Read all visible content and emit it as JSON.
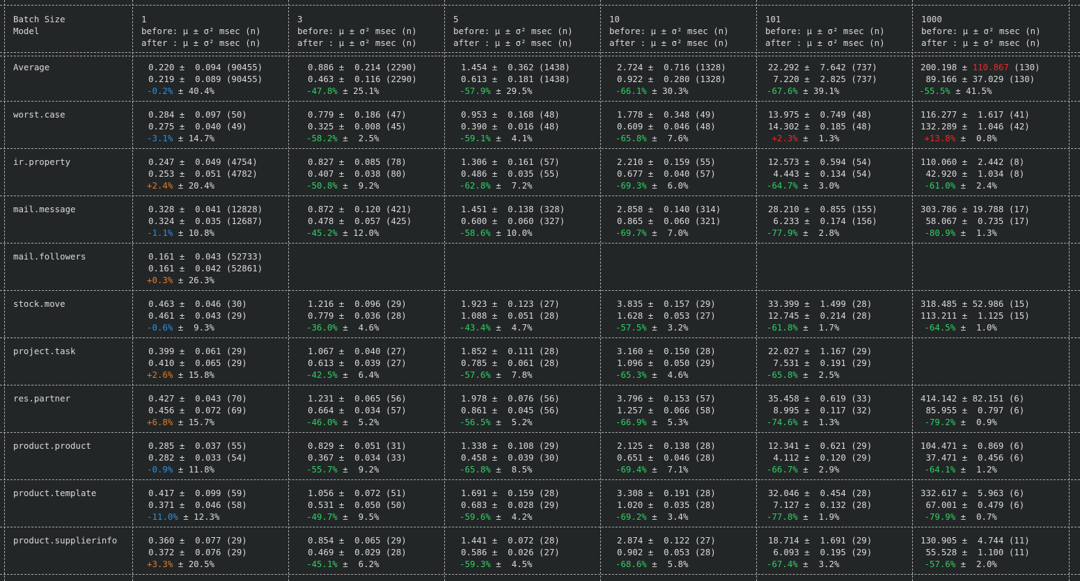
{
  "colors": {
    "background": "#232627",
    "text": "#d9dadb",
    "improvement": "#2ed065",
    "slight_improvement": "#2b8fe0",
    "slight_regression": "#e07a2b",
    "regression": "#e8292d"
  },
  "header": {
    "model_col": [
      "Batch Size",
      "Model"
    ],
    "batch_sizes": [
      "1",
      "3",
      "5",
      "10",
      "101",
      "1000"
    ],
    "before_label": "before: μ ± σ² msec (n)",
    "after_label": "after : μ ± σ² msec (n)"
  },
  "rows": [
    {
      "model": "Average",
      "cells": [
        {
          "before": "0.220 ±  0.094 (90455)",
          "after": "0.219 ±  0.089 (90455)",
          "pct": "-0.2%",
          "rest": " ± 40.4%",
          "tone": "blue"
        },
        {
          "before": "0.886 ±  0.214 (2290)",
          "after": "0.463 ±  0.116 (2290)",
          "pct": "-47.8%",
          "rest": " ± 25.1%",
          "tone": "green"
        },
        {
          "before": "1.454 ±  0.362 (1438)",
          "after": "0.613 ±  0.181 (1438)",
          "pct": "-57.9%",
          "rest": " ± 29.5%",
          "tone": "green"
        },
        {
          "before": "2.724 ±  0.716 (1328)",
          "after": "0.922 ±  0.280 (1328)",
          "pct": "-66.1%",
          "rest": " ± 30.3%",
          "tone": "green"
        },
        {
          "before": "22.292 ±  7.642 (737)",
          "after": " 7.220 ±  2.825 (737)",
          "pct": "-67.6%",
          "rest": " ± 39.1%",
          "tone": "green"
        },
        {
          "before_pre": "200.198 ± ",
          "before_hl": "110.867",
          "before_post": " (130)",
          "after": " 89.166 ± 37.029 (130)",
          "pct": "-55.5%",
          "rest": " ± 41.5%",
          "tone": "green"
        }
      ]
    },
    {
      "model": "worst.case",
      "cells": [
        {
          "before": "0.284 ±  0.097 (50)",
          "after": "0.275 ±  0.040 (49)",
          "pct": "-3.1%",
          "rest": " ± 14.7%",
          "tone": "blue"
        },
        {
          "before": "0.779 ±  0.186 (47)",
          "after": "0.325 ±  0.008 (45)",
          "pct": "-58.2%",
          "rest": " ±  2.5%",
          "tone": "green"
        },
        {
          "before": "0.953 ±  0.168 (48)",
          "after": "0.390 ±  0.016 (48)",
          "pct": "-59.1%",
          "rest": " ±  4.1%",
          "tone": "green"
        },
        {
          "before": "1.778 ±  0.348 (49)",
          "after": "0.609 ±  0.046 (48)",
          "pct": "-65.8%",
          "rest": " ±  7.6%",
          "tone": "green"
        },
        {
          "before": "13.975 ±  0.749 (48)",
          "after": "14.302 ±  0.185 (48)",
          "pct": " +2.3%",
          "rest": " ±  1.3%",
          "tone": "red"
        },
        {
          "before": "116.277 ±  1.617 (41)",
          "after": "132.289 ±  1.046 (42)",
          "pct": " +13.8%",
          "rest": " ±  0.8%",
          "tone": "red"
        }
      ]
    },
    {
      "model": "ir.property",
      "cells": [
        {
          "before": "0.247 ±  0.049 (4754)",
          "after": "0.253 ±  0.051 (4782)",
          "pct": "+2.4%",
          "rest": " ± 20.4%",
          "tone": "orange"
        },
        {
          "before": "0.827 ±  0.085 (78)",
          "after": "0.407 ±  0.038 (80)",
          "pct": "-50.8%",
          "rest": " ±  9.2%",
          "tone": "green"
        },
        {
          "before": "1.306 ±  0.161 (57)",
          "after": "0.486 ±  0.035 (55)",
          "pct": "-62.8%",
          "rest": " ±  7.2%",
          "tone": "green"
        },
        {
          "before": "2.210 ±  0.159 (55)",
          "after": "0.677 ±  0.040 (57)",
          "pct": "-69.3%",
          "rest": " ±  6.0%",
          "tone": "green"
        },
        {
          "before": "12.573 ±  0.594 (54)",
          "after": " 4.443 ±  0.134 (54)",
          "pct": "-64.7%",
          "rest": " ±  3.0%",
          "tone": "green"
        },
        {
          "before": "110.060 ±  2.442 (8)",
          "after": " 42.920 ±  1.034 (8)",
          "pct": " -61.0%",
          "rest": " ±  2.4%",
          "tone": "green"
        }
      ]
    },
    {
      "model": "mail.message",
      "cells": [
        {
          "before": "0.328 ±  0.041 (12828)",
          "after": "0.324 ±  0.035 (12687)",
          "pct": "-1.1%",
          "rest": " ± 10.8%",
          "tone": "blue"
        },
        {
          "before": "0.872 ±  0.120 (421)",
          "after": "0.478 ±  0.057 (425)",
          "pct": "-45.2%",
          "rest": " ± 12.0%",
          "tone": "green"
        },
        {
          "before": "1.451 ±  0.138 (328)",
          "after": "0.600 ±  0.060 (327)",
          "pct": "-58.6%",
          "rest": " ± 10.0%",
          "tone": "green"
        },
        {
          "before": "2.858 ±  0.140 (314)",
          "after": "0.865 ±  0.060 (321)",
          "pct": "-69.7%",
          "rest": " ±  7.0%",
          "tone": "green"
        },
        {
          "before": "28.210 ±  0.855 (155)",
          "after": " 6.233 ±  0.174 (156)",
          "pct": "-77.9%",
          "rest": " ±  2.8%",
          "tone": "green"
        },
        {
          "before": "303.786 ± 19.788 (17)",
          "after": " 58.067 ±  0.735 (17)",
          "pct": " -80.9%",
          "rest": " ±  1.3%",
          "tone": "green"
        }
      ]
    },
    {
      "model": "mail.followers",
      "cells": [
        {
          "before": "0.161 ±  0.043 (52733)",
          "after": "0.161 ±  0.042 (52861)",
          "pct": "+0.3%",
          "rest": " ± 26.3%",
          "tone": "orange"
        },
        null,
        null,
        null,
        null,
        null
      ]
    },
    {
      "model": "stock.move",
      "cells": [
        {
          "before": "0.463 ±  0.046 (30)",
          "after": "0.461 ±  0.043 (29)",
          "pct": "-0.6%",
          "rest": " ±  9.3%",
          "tone": "blue"
        },
        {
          "before": "1.216 ±  0.096 (29)",
          "after": "0.779 ±  0.036 (28)",
          "pct": "-36.0%",
          "rest": " ±  4.6%",
          "tone": "green"
        },
        {
          "before": "1.923 ±  0.123 (27)",
          "after": "1.088 ±  0.051 (28)",
          "pct": "-43.4%",
          "rest": " ±  4.7%",
          "tone": "green"
        },
        {
          "before": "3.835 ±  0.157 (29)",
          "after": "1.628 ±  0.053 (27)",
          "pct": "-57.5%",
          "rest": " ±  3.2%",
          "tone": "green"
        },
        {
          "before": "33.399 ±  1.499 (28)",
          "after": "12.745 ±  0.214 (28)",
          "pct": "-61.8%",
          "rest": " ±  1.7%",
          "tone": "green"
        },
        {
          "before": "318.485 ± 52.986 (15)",
          "after": "113.211 ±  1.125 (15)",
          "pct": " -64.5%",
          "rest": " ±  1.0%",
          "tone": "green"
        }
      ]
    },
    {
      "model": "project.task",
      "cells": [
        {
          "before": "0.399 ±  0.061 (29)",
          "after": "0.410 ±  0.065 (29)",
          "pct": "+2.6%",
          "rest": " ± 15.8%",
          "tone": "orange"
        },
        {
          "before": "1.067 ±  0.040 (27)",
          "after": "0.613 ±  0.039 (27)",
          "pct": "-42.5%",
          "rest": " ±  6.4%",
          "tone": "green"
        },
        {
          "before": "1.852 ±  0.111 (28)",
          "after": "0.785 ±  0.061 (28)",
          "pct": "-57.6%",
          "rest": " ±  7.8%",
          "tone": "green"
        },
        {
          "before": "3.160 ±  0.150 (28)",
          "after": "1.096 ±  0.050 (29)",
          "pct": "-65.3%",
          "rest": " ±  4.6%",
          "tone": "green"
        },
        {
          "before": "22.027 ±  1.167 (29)",
          "after": " 7.531 ±  0.191 (29)",
          "pct": "-65.8%",
          "rest": " ±  2.5%",
          "tone": "green"
        },
        null
      ]
    },
    {
      "model": "res.partner",
      "cells": [
        {
          "before": "0.427 ±  0.043 (70)",
          "after": "0.456 ±  0.072 (69)",
          "pct": "+6.8%",
          "rest": " ± 15.7%",
          "tone": "orange"
        },
        {
          "before": "1.231 ±  0.065 (56)",
          "after": "0.664 ±  0.034 (57)",
          "pct": "-46.0%",
          "rest": " ±  5.2%",
          "tone": "green"
        },
        {
          "before": "1.978 ±  0.076 (56)",
          "after": "0.861 ±  0.045 (56)",
          "pct": "-56.5%",
          "rest": " ±  5.2%",
          "tone": "green"
        },
        {
          "before": "3.796 ±  0.153 (57)",
          "after": "1.257 ±  0.066 (58)",
          "pct": "-66.9%",
          "rest": " ±  5.3%",
          "tone": "green"
        },
        {
          "before": "35.458 ±  0.619 (33)",
          "after": " 8.995 ±  0.117 (32)",
          "pct": "-74.6%",
          "rest": " ±  1.3%",
          "tone": "green"
        },
        {
          "before": "414.142 ± 82.151 (6)",
          "after": " 85.955 ±  0.797 (6)",
          "pct": " -79.2%",
          "rest": " ±  0.9%",
          "tone": "green"
        }
      ]
    },
    {
      "model": "product.product",
      "cells": [
        {
          "before": "0.285 ±  0.037 (55)",
          "after": "0.282 ±  0.033 (54)",
          "pct": "-0.9%",
          "rest": " ± 11.8%",
          "tone": "blue"
        },
        {
          "before": "0.829 ±  0.051 (31)",
          "after": "0.367 ±  0.034 (33)",
          "pct": "-55.7%",
          "rest": " ±  9.2%",
          "tone": "green"
        },
        {
          "before": "1.338 ±  0.108 (29)",
          "after": "0.458 ±  0.039 (30)",
          "pct": "-65.8%",
          "rest": " ±  8.5%",
          "tone": "green"
        },
        {
          "before": "2.125 ±  0.138 (28)",
          "after": "0.651 ±  0.046 (28)",
          "pct": "-69.4%",
          "rest": " ±  7.1%",
          "tone": "green"
        },
        {
          "before": "12.341 ±  0.621 (29)",
          "after": " 4.112 ±  0.120 (29)",
          "pct": "-66.7%",
          "rest": " ±  2.9%",
          "tone": "green"
        },
        {
          "before": "104.471 ±  0.869 (6)",
          "after": " 37.471 ±  0.456 (6)",
          "pct": " -64.1%",
          "rest": " ±  1.2%",
          "tone": "green"
        }
      ]
    },
    {
      "model": "product.template",
      "cells": [
        {
          "before": "0.417 ±  0.099 (59)",
          "after": "0.371 ±  0.046 (58)",
          "pct": "-11.0%",
          "rest": " ± 12.3%",
          "tone": "blue"
        },
        {
          "before": "1.056 ±  0.072 (51)",
          "after": "0.531 ±  0.050 (50)",
          "pct": "-49.7%",
          "rest": " ±  9.5%",
          "tone": "green"
        },
        {
          "before": "1.691 ±  0.159 (28)",
          "after": "0.683 ±  0.028 (29)",
          "pct": "-59.6%",
          "rest": " ±  4.2%",
          "tone": "green"
        },
        {
          "before": "3.308 ±  0.191 (28)",
          "after": "1.020 ±  0.035 (28)",
          "pct": "-69.2%",
          "rest": " ±  3.4%",
          "tone": "green"
        },
        {
          "before": "32.046 ±  0.454 (28)",
          "after": " 7.127 ±  0.132 (28)",
          "pct": "-77.8%",
          "rest": " ±  1.9%",
          "tone": "green"
        },
        {
          "before": "332.617 ±  5.963 (6)",
          "after": " 67.001 ±  0.479 (6)",
          "pct": " -79.9%",
          "rest": " ±  0.7%",
          "tone": "green"
        }
      ]
    },
    {
      "model": "product.supplierinfo",
      "cells": [
        {
          "before": "0.360 ±  0.077 (29)",
          "after": "0.372 ±  0.076 (29)",
          "pct": "+3.3%",
          "rest": " ± 20.5%",
          "tone": "orange"
        },
        {
          "before": "0.854 ±  0.065 (29)",
          "after": "0.469 ±  0.029 (28)",
          "pct": "-45.1%",
          "rest": " ±  6.2%",
          "tone": "green"
        },
        {
          "before": "1.441 ±  0.072 (28)",
          "after": "0.586 ±  0.026 (27)",
          "pct": "-59.3%",
          "rest": " ±  4.5%",
          "tone": "green"
        },
        {
          "before": "2.874 ±  0.122 (27)",
          "after": "0.902 ±  0.053 (28)",
          "pct": "-68.6%",
          "rest": " ±  5.8%",
          "tone": "green"
        },
        {
          "before": "18.714 ±  1.691 (29)",
          "after": " 6.093 ±  0.195 (29)",
          "pct": "-67.4%",
          "rest": " ±  3.2%",
          "tone": "green"
        },
        {
          "before": "130.905 ±  4.744 (11)",
          "after": " 55.528 ±  1.100 (11)",
          "pct": " -57.6%",
          "rest": " ±  2.0%",
          "tone": "green"
        }
      ]
    }
  ]
}
